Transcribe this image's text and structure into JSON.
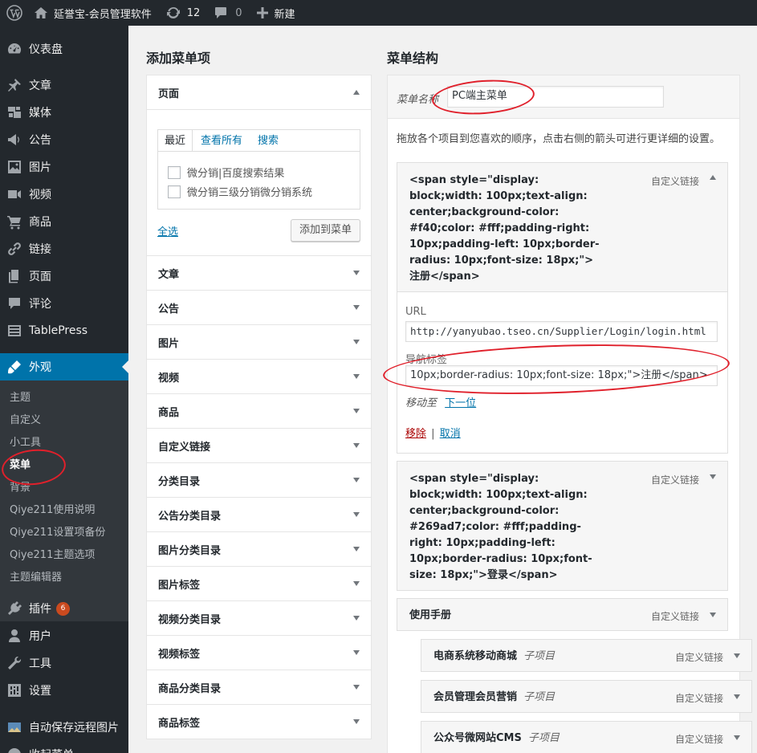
{
  "admin_bar": {
    "site_name": "延誉宝-会员管理软件",
    "updates_count": "12",
    "comments_count": "0",
    "new_label": "新建"
  },
  "sidebar": {
    "items": [
      {
        "label": "仪表盘",
        "icon": "dashboard-icon"
      },
      {
        "label": "文章",
        "icon": "pin-icon"
      },
      {
        "label": "媒体",
        "icon": "media-icon"
      },
      {
        "label": "公告",
        "icon": "megaphone-icon"
      },
      {
        "label": "图片",
        "icon": "image-icon"
      },
      {
        "label": "视频",
        "icon": "video-icon"
      },
      {
        "label": "商品",
        "icon": "cart-icon"
      },
      {
        "label": "链接",
        "icon": "link-icon"
      },
      {
        "label": "页面",
        "icon": "page-icon"
      },
      {
        "label": "评论",
        "icon": "comment-icon"
      },
      {
        "label": "TablePress",
        "icon": "table-icon"
      },
      {
        "label": "外观",
        "icon": "brush-icon"
      }
    ],
    "appearance_submenu": [
      "主题",
      "自定义",
      "小工具",
      "菜单",
      "背景",
      "Qiye211使用说明",
      "Qiye211设置项备份",
      "Qiye211主题选项",
      "主题编辑器"
    ],
    "lower_items": [
      {
        "label": "插件",
        "icon": "plugin-icon",
        "badge": "6"
      },
      {
        "label": "用户",
        "icon": "user-icon"
      },
      {
        "label": "工具",
        "icon": "wrench-icon"
      },
      {
        "label": "设置",
        "icon": "settings-icon"
      },
      {
        "label": "自动保存远程图片",
        "icon": "image-save-icon"
      },
      {
        "label": "收起菜单",
        "icon": "collapse-icon"
      }
    ]
  },
  "left_column": {
    "heading": "添加菜单项",
    "pages_section": {
      "title": "页面",
      "tabs": [
        "最近",
        "查看所有",
        "搜索"
      ],
      "checkbox_items": [
        "微分销|百度搜索结果",
        "微分销三级分销微分销系统"
      ],
      "select_all": "全选",
      "add_button": "添加到菜单"
    },
    "collapsed_sections": [
      "文章",
      "公告",
      "图片",
      "视频",
      "商品",
      "自定义链接",
      "分类目录",
      "公告分类目录",
      "图片分类目录",
      "图片标签",
      "视频分类目录",
      "视频标签",
      "商品分类目录",
      "商品标签"
    ]
  },
  "right_column": {
    "heading": "菜单结构",
    "menu_name_label": "菜单名称",
    "menu_name_value": "PC端主菜单",
    "instructions": "拖放各个项目到您喜欢的顺序，点击右侧的箭头可进行更详细的设置。",
    "item1": {
      "title_lines": [
        "<span style=\"display:",
        "block;width: 100px;text-align:",
        "center;background-color:",
        "#f40;color: #fff;padding-right:",
        "10px;padding-left: 10px;border-",
        "radius: 10px;font-size: 18px;\">",
        "注册</span>"
      ],
      "type": "自定义链接",
      "url_label": "URL",
      "url_value": "http://yanyubao.tseo.cn/Supplier/Login/login.html",
      "nav_label": "导航标签",
      "nav_value": "10px;border-radius: 10px;font-size: 18px;\">注册</span>",
      "move_label": "移动至",
      "move_link": "下一位",
      "remove_link": "移除",
      "separator": "|",
      "cancel_link": "取消"
    },
    "item2": {
      "title_lines": [
        "<span style=\"display:",
        "block;width: 100px;text-align:",
        "center;background-color:",
        "#269ad7;color: #fff;padding-",
        "right: 10px;padding-left:",
        "10px;border-radius: 10px;font-",
        "size: 18px;\">登录</span>"
      ],
      "type": "自定义链接"
    },
    "item3": {
      "title": "使用手册",
      "type": "自定义链接"
    },
    "subitems": [
      {
        "title": "电商系统移动商城",
        "badge": "子项目",
        "type": "自定义链接"
      },
      {
        "title": "会员管理会员营销",
        "badge": "子项目",
        "type": "自定义链接"
      },
      {
        "title": "公众号微网站CMS",
        "badge": "子项目",
        "type": "自定义链接"
      }
    ]
  },
  "annotation_color": "#e0202b",
  "accent_color": "#0073aa"
}
